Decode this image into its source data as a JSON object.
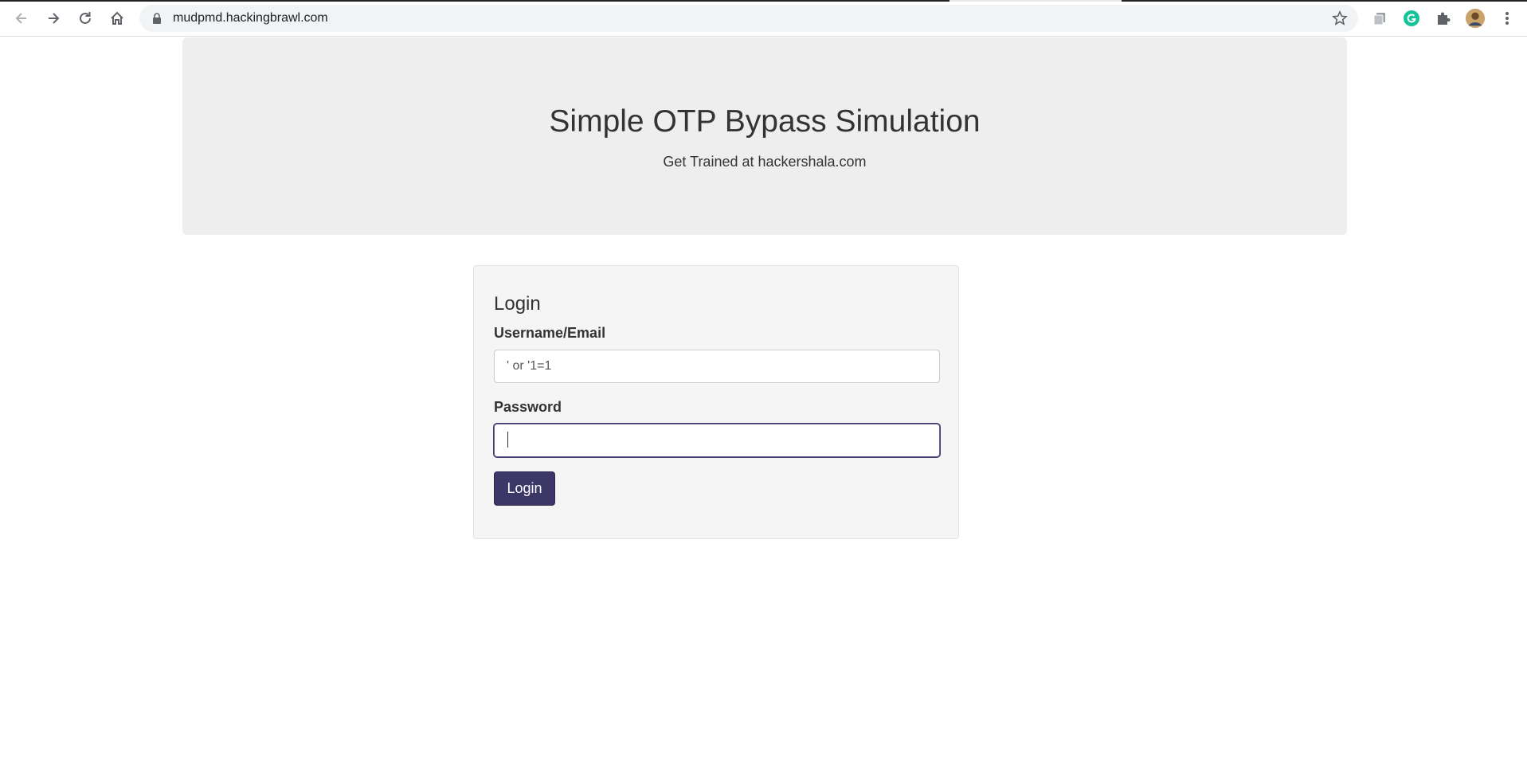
{
  "browser": {
    "url": "mudpmd.hackingbrawl.com",
    "icons": [
      "back-icon",
      "forward-icon",
      "reload-icon",
      "home-icon",
      "lock-icon",
      "star-icon",
      "extension-pages-icon",
      "grammarly-icon",
      "extensions-puzzle-icon",
      "profile-avatar",
      "menu-kebab-icon"
    ]
  },
  "hero": {
    "title": "Simple OTP Bypass Simulation",
    "subtitle": "Get Trained at hackershala.com"
  },
  "login": {
    "legend": "Login",
    "username_label": "Username/Email",
    "username_value": "' or '1=1",
    "password_label": "Password",
    "password_value": "",
    "submit_label": "Login"
  },
  "colors": {
    "hero_bg": "#eeeeee",
    "panel_bg": "#f5f5f5",
    "button_bg": "#3d3768",
    "grammarly": "#15c39a"
  }
}
